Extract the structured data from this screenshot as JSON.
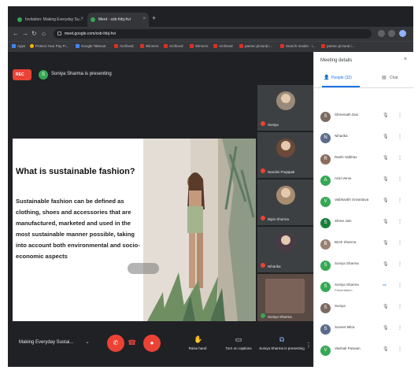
{
  "browser": {
    "tabs": [
      {
        "label": "Invitation: Making Everyday Su..."
      },
      {
        "label": "Meet - xxb-fxbj-hvi"
      }
    ],
    "new_tab": "+",
    "url": "meet.google.com/xxb-fxbj-hvi",
    "bookmarks": [
      "Apps",
      "Protect Your Pay Fi...",
      "Google Takeout",
      "Archived",
      "Winners",
      "Archived",
      "Winners",
      "Archived",
      "parsec.pictural.i...",
      "Search results - i...",
      "parsec.pictural.i..."
    ]
  },
  "meet": {
    "rec_label": "REC",
    "presenter_initial": "S",
    "presenting_text": "Soniya Sharma is presenting",
    "slide": {
      "title": "What is sustainable fashion?",
      "body": "Sustainable fashion can be defined as clothing, shoes and accessories that are manufactured, marketed and used in the most sustainable manner possible, taking into account both environmental and socio-economic aspects"
    },
    "tiles": [
      {
        "name": "Soniya"
      },
      {
        "name": "Nandini Prajapati"
      },
      {
        "name": "Bipin Sharma"
      },
      {
        "name": "Niharika"
      },
      {
        "name": "Soniya Sharma"
      }
    ],
    "controls": {
      "meeting_title": "Making Everyday Sustai...",
      "raise_hand": "Raise hand",
      "captions": "Turn on captions",
      "present": "Soniya Sharma is presenting"
    }
  },
  "panel": {
    "title": "Meeting details",
    "tab_people": "People (32)",
    "tab_chat": "Chat",
    "participants": [
      {
        "initial": "S",
        "name": "Shreenath Das",
        "sub": "",
        "color": "#7a6a5f"
      },
      {
        "initial": "N",
        "name": "Niharika",
        "sub": "",
        "color": "#5a6b8c"
      },
      {
        "initial": "R",
        "name": "Rashi Vaibhav",
        "sub": "",
        "color": "#8b6b5c"
      },
      {
        "initial": "A",
        "name": "Anki Verve",
        "sub": "",
        "color": "#34a853"
      },
      {
        "initial": "V",
        "name": "Vaibhavbh Srivastava",
        "sub": "",
        "color": "#34a853"
      },
      {
        "initial": "S",
        "name": "Shree Jain",
        "sub": "",
        "color": "#188038"
      },
      {
        "initial": "B",
        "name": "Birsh Sharma",
        "sub": "",
        "color": "#9a8070"
      },
      {
        "initial": "S",
        "name": "Soniya Sharma",
        "sub": "",
        "color": "#34a853"
      },
      {
        "initial": "S",
        "name": "Soniya Sharma",
        "sub": "Presentation",
        "color": "#34a853"
      },
      {
        "initial": "S",
        "name": "Suniya",
        "sub": "",
        "color": "#7a6a5f"
      },
      {
        "initial": "S",
        "name": "Suneet Mitra",
        "sub": "",
        "color": "#5a6b8c"
      },
      {
        "initial": "V",
        "name": "Vaishali Paswan",
        "sub": "",
        "color": "#34a853"
      }
    ]
  }
}
